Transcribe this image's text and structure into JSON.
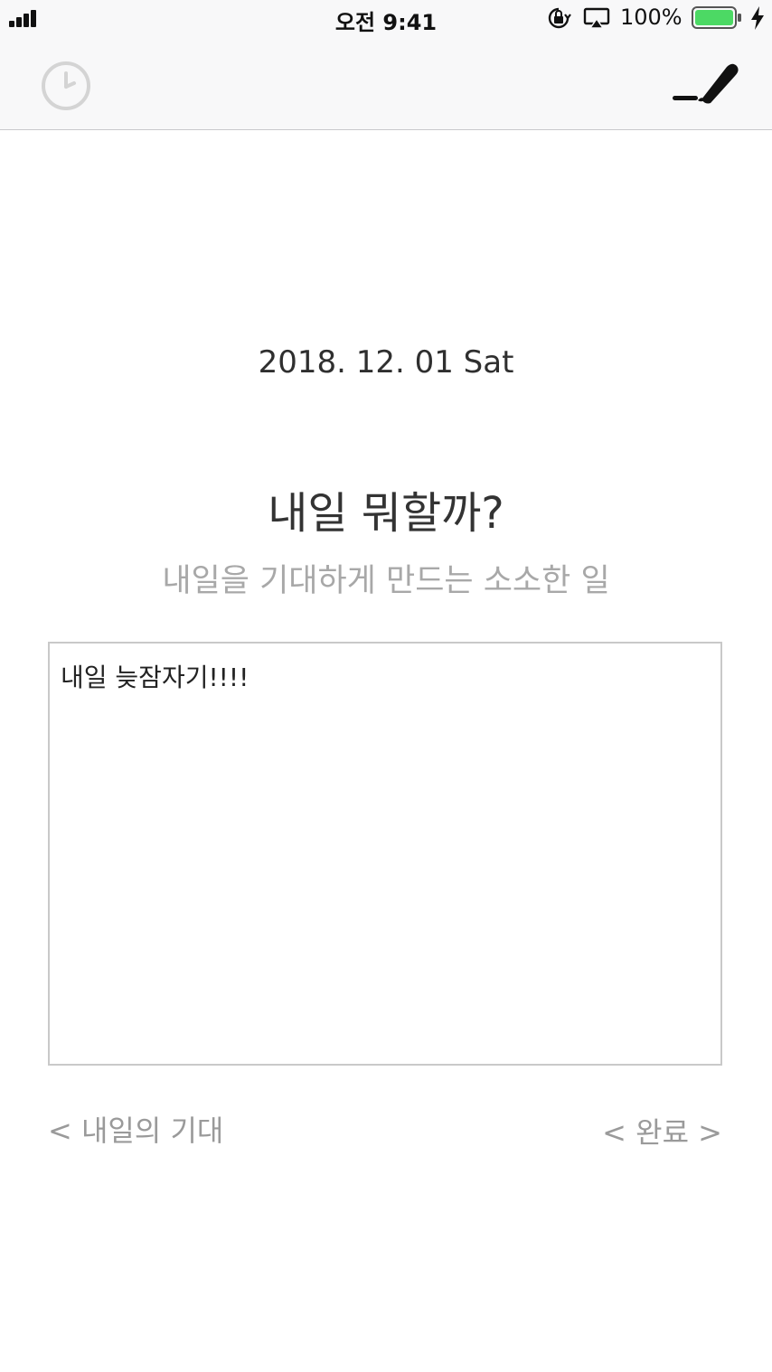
{
  "status_bar": {
    "time": "오전 9:41",
    "battery_percent": "100%",
    "battery_level": 1.0,
    "battery_color": "#4cd964",
    "icons": [
      "signal-icon",
      "rotation-lock-icon",
      "airplay-icon",
      "battery-icon",
      "charging-icon"
    ]
  },
  "nav": {
    "left_icon": "clock-icon",
    "right_icon": "pen-icon"
  },
  "main": {
    "date": "2018. 12. 01 Sat",
    "question": "내일 뭐할까?",
    "subtitle": "내일을 기대하게 만드는 소소한 일",
    "entry_text": "내일 늦잠자기!!!!"
  },
  "footer": {
    "prev_label": "< 내일의 기대",
    "done_label": "< 완료 >"
  }
}
